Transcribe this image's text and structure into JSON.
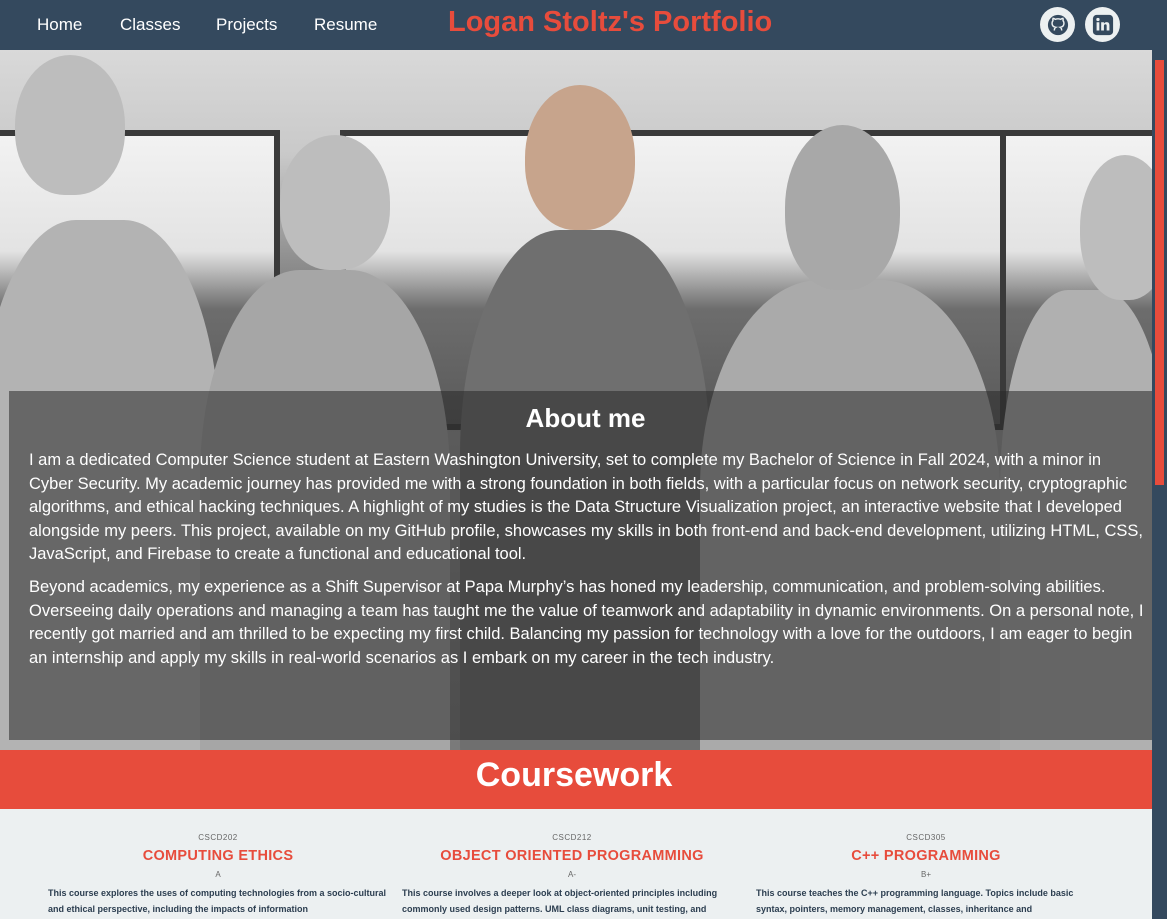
{
  "nav": {
    "links": [
      "Home",
      "Classes",
      "Projects",
      "Resume"
    ],
    "title": "Logan Stoltz's Portfolio",
    "social": [
      "github-icon",
      "linkedin-icon"
    ]
  },
  "about": {
    "title": "About me",
    "paragraphs": [
      "I am a dedicated Computer Science student at Eastern Washington University, set to complete my Bachelor of Science in Fall 2024, with a minor in Cyber Security. My academic journey has provided me with a strong foundation in both fields, with a particular focus on network security, cryptographic algorithms, and ethical hacking techniques. A highlight of my studies is the Data Structure Visualization project, an interactive website that I developed alongside my peers. This project, available on my GitHub profile, showcases my skills in both front-end and back-end development, utilizing HTML, CSS, JavaScript, and Firebase to create a functional and educational tool.",
      "Beyond academics, my experience as a Shift Supervisor at Papa Murphy’s has honed my leadership, communication, and problem-solving abilities. Overseeing daily operations and managing a team has taught me the value of teamwork and adaptability in dynamic environments. On a personal note, I recently got married and am thrilled to be expecting my first child. Balancing my passion for technology with a love for the outdoors, I am eager to begin an internship and apply my skills in real-world scenarios as I embark on my career in the tech industry."
    ]
  },
  "coursework": {
    "title": "Coursework",
    "courses": [
      {
        "code": "CSCD202",
        "name": "COMPUTING ETHICS",
        "grade": "A",
        "description": "This course explores the uses of computing technologies from a socio-cultural and ethical perspective, including the impacts of information"
      },
      {
        "code": "CSCD212",
        "name": "OBJECT ORIENTED PROGRAMMING",
        "grade": "A-",
        "description": "This course involves a deeper look at object-oriented principles including commonly used design patterns. UML class diagrams, unit testing, and"
      },
      {
        "code": "CSCD305",
        "name": "C++ PROGRAMMING",
        "grade": "B+",
        "description": "This course teaches the C++ programming language. Topics include basic syntax, pointers, memory management, classes, inheritance and"
      }
    ]
  },
  "colors": {
    "nav_bg": "#34495e",
    "accent": "#e74c3c",
    "light_bg": "#ecf0f1"
  }
}
